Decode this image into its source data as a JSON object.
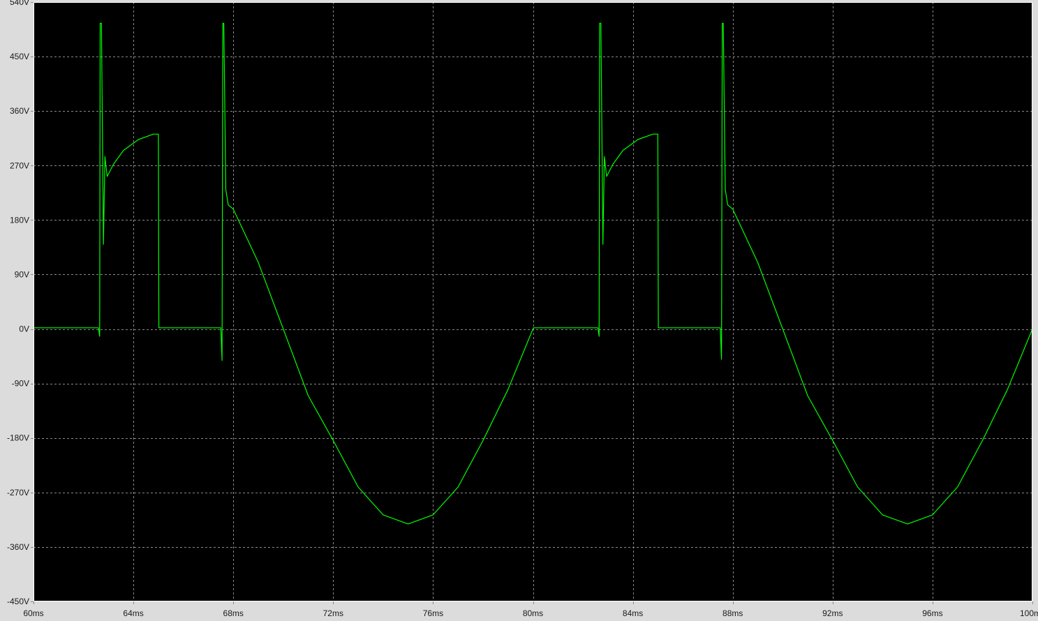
{
  "chart_data": {
    "type": "line",
    "title": "",
    "xlabel": "",
    "ylabel": "",
    "xlim": [
      60,
      100
    ],
    "ylim": [
      -450,
      540
    ],
    "grid": true,
    "background": "#000000",
    "frame_color": "#ffffff",
    "x_ticks": [
      {
        "value": 60,
        "label": "60ms"
      },
      {
        "value": 64,
        "label": "64ms"
      },
      {
        "value": 68,
        "label": "68ms"
      },
      {
        "value": 72,
        "label": "72ms"
      },
      {
        "value": 76,
        "label": "76ms"
      },
      {
        "value": 80,
        "label": "80ms"
      },
      {
        "value": 84,
        "label": "84ms"
      },
      {
        "value": 88,
        "label": "88ms"
      },
      {
        "value": 92,
        "label": "92ms"
      },
      {
        "value": 96,
        "label": "96ms"
      },
      {
        "value": 100,
        "label": "100ms"
      }
    ],
    "y_ticks": [
      {
        "value": 540,
        "label": "540V"
      },
      {
        "value": 450,
        "label": "450V"
      },
      {
        "value": 360,
        "label": "360V"
      },
      {
        "value": 270,
        "label": "270V"
      },
      {
        "value": 180,
        "label": "180V"
      },
      {
        "value": 90,
        "label": "90V"
      },
      {
        "value": 0,
        "label": "0V"
      },
      {
        "value": -90,
        "label": "-90V"
      },
      {
        "value": -180,
        "label": "-180V"
      },
      {
        "value": -270,
        "label": "-270V"
      },
      {
        "value": -360,
        "label": "-360V"
      },
      {
        "value": -450,
        "label": "-450V"
      }
    ],
    "series": [
      {
        "color": "#00ff00",
        "x": [
          60,
          62.6,
          62.65,
          62.67,
          62.72,
          62.76,
          62.8,
          62.86,
          62.95,
          63.2,
          63.6,
          64.2,
          64.8,
          65.0,
          65.02,
          67.5,
          67.55,
          67.58,
          67.62,
          67.7,
          67.8,
          68.0,
          68.5,
          69.0,
          70.0,
          71.0,
          72.0,
          73.0,
          74.0,
          75.0,
          76.0,
          77.0,
          78.0,
          79.0,
          80.0,
          80.02,
          82.6,
          82.65,
          82.67,
          82.72,
          82.76,
          82.8,
          82.86,
          82.95,
          83.2,
          83.6,
          84.2,
          84.8,
          85.0,
          85.02,
          87.5,
          87.55,
          87.58,
          87.62,
          87.7,
          87.8,
          88.0,
          88.5,
          89.0,
          90.0,
          91.0,
          92.0,
          93.0,
          94.0,
          95.0,
          96.0,
          97.0,
          98.0,
          99.0,
          100.0
        ],
        "y": [
          2,
          2,
          -12,
          505,
          505,
          330,
          140,
          285,
          252,
          272,
          295,
          313,
          322,
          322,
          2,
          2,
          -52,
          505,
          505,
          230,
          205,
          198,
          154,
          110,
          0,
          -110,
          -184,
          -261,
          -307,
          -322,
          -307,
          -261,
          -184,
          -100,
          0,
          2,
          2,
          -12,
          505,
          505,
          330,
          140,
          285,
          252,
          272,
          295,
          313,
          322,
          322,
          2,
          2,
          -50,
          505,
          505,
          230,
          205,
          198,
          154,
          110,
          0,
          -110,
          -184,
          -261,
          -307,
          -322,
          -307,
          -261,
          -184,
          -100,
          0
        ]
      }
    ]
  }
}
